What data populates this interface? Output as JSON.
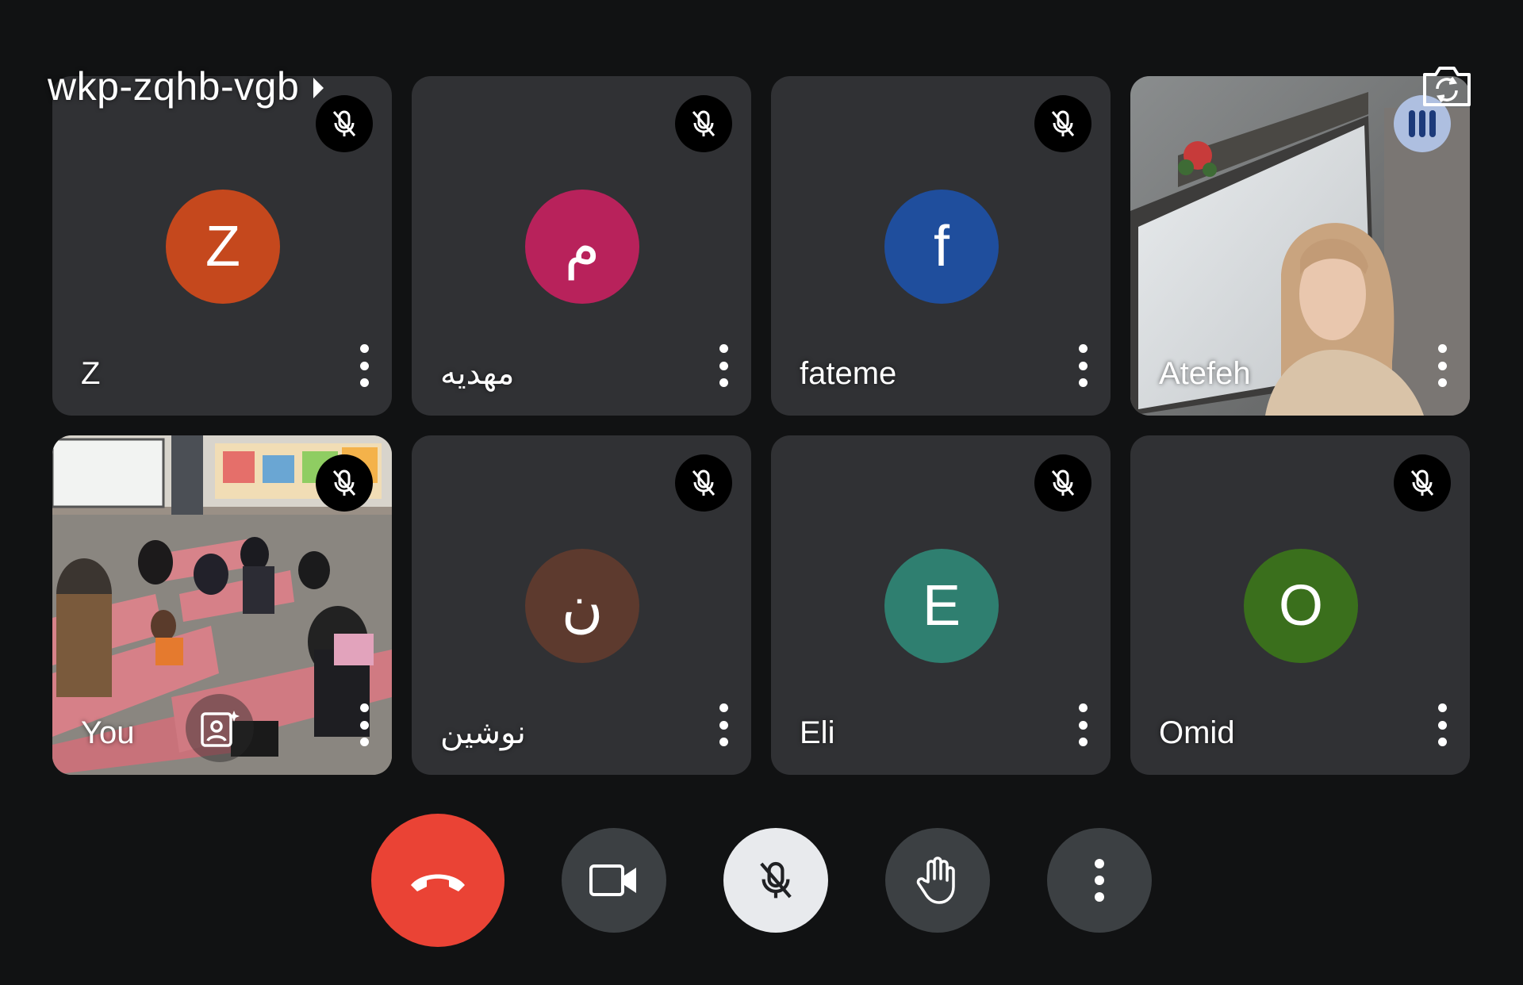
{
  "meeting": {
    "code": "wkp-zqhb-vgb"
  },
  "participants": [
    {
      "name": "Z",
      "initial": "Z",
      "avatar_color": "#c5481d",
      "muted": true,
      "video": false,
      "rtl": false
    },
    {
      "name": "مهدیه",
      "initial": "م",
      "avatar_color": "#b8225b",
      "muted": true,
      "video": false,
      "rtl": true
    },
    {
      "name": "fateme",
      "initial": "f",
      "avatar_color": "#1f4e9d",
      "muted": true,
      "video": false,
      "rtl": false
    },
    {
      "name": "Atefeh",
      "initial": "",
      "avatar_color": "",
      "muted": false,
      "speaking": true,
      "video": true,
      "rtl": false
    },
    {
      "name": "You",
      "initial": "",
      "avatar_color": "",
      "muted": true,
      "video": true,
      "self": true,
      "rtl": false
    },
    {
      "name": "نوشین",
      "initial": "ن",
      "avatar_color": "#5d3a2e",
      "muted": true,
      "video": false,
      "rtl": true
    },
    {
      "name": "Eli",
      "initial": "E",
      "avatar_color": "#2f7f70",
      "muted": true,
      "video": false,
      "rtl": false
    },
    {
      "name": "Omid",
      "initial": "O",
      "avatar_color": "#3a6f1c",
      "muted": true,
      "video": false,
      "rtl": false
    }
  ],
  "controls": {
    "icons": [
      "phone-hangup-icon",
      "camera-icon",
      "mic-off-icon",
      "raise-hand-icon",
      "more-vert-icon"
    ]
  },
  "colors": {
    "end_call": "#ea4335",
    "tile_bg": "#303134",
    "control_bg": "#3c4043",
    "mic_bg": "#e8eaed"
  }
}
